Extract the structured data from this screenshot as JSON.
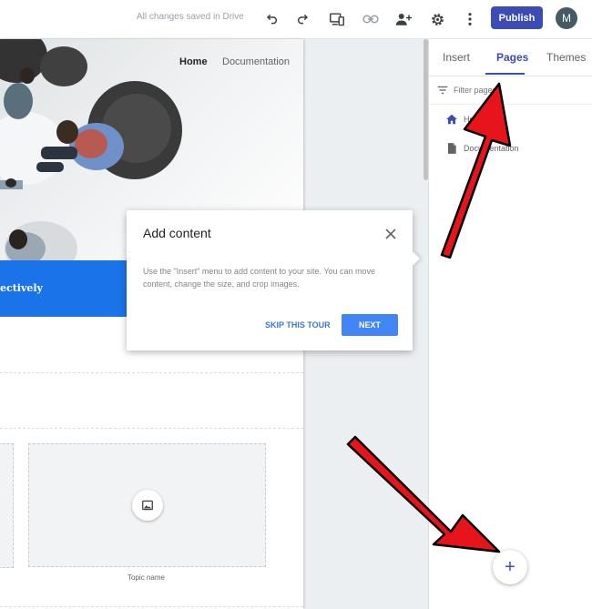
{
  "topbar": {
    "saved_status": "All changes saved in Drive",
    "publish_label": "Publish",
    "avatar_initial": "M"
  },
  "site": {
    "nav": {
      "home": "Home",
      "documentation": "Documentation"
    },
    "banner_text": "ectively",
    "topic_name": "Topic name"
  },
  "panel": {
    "tabs": [
      {
        "label": "Insert"
      },
      {
        "label": "Pages"
      },
      {
        "label": "Themes"
      }
    ],
    "active_tab": "Pages",
    "filter_placeholder": "Filter pages",
    "pages": [
      {
        "label": "Home",
        "icon": "home-icon"
      },
      {
        "label": "Documentation",
        "icon": "document-icon"
      }
    ],
    "fab_label": "+"
  },
  "dialog": {
    "title": "Add content",
    "body": "Use the \"Insert\" menu to add content to your site. You can move content, change the size, and crop images.",
    "skip_label": "SKIP THIS TOUR",
    "next_label": "NEXT"
  },
  "colors": {
    "accent": "#3c4cb5",
    "banner": "#1a73e8",
    "next_button": "#4285f4",
    "annotation_arrow": "#e8141b"
  }
}
